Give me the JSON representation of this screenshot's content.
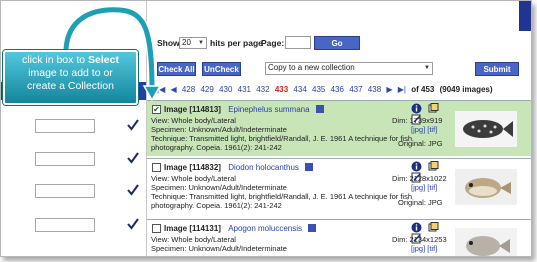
{
  "toolbar": {
    "show_label": "Show:",
    "show_value": "20",
    "hits_per_page_label": "hits per page",
    "page_label": "Page:",
    "page_value": "",
    "go_label": "Go",
    "check_all_label": "Check All",
    "uncheck_label": "UnCheck",
    "action_value": "Copy to a new collection",
    "submit_label": "Submit"
  },
  "pager": {
    "pages": [
      "428",
      "429",
      "430",
      "431",
      "432",
      "433",
      "434",
      "435",
      "436",
      "437",
      "438"
    ],
    "current": "433",
    "of_label": "of 453",
    "count_label": "(9049 images)"
  },
  "results": [
    {
      "checked": true,
      "image_label": "Image",
      "image_id": "[114813]",
      "species": "Epinephelus summana",
      "view": "View: Whole body/Lateral",
      "specimen": "Specimen: Unknown/Adult/Indeterminate",
      "technique": "Technique: Transmitted light, brightfield/Randall, J. E. 1961 A technique for fish",
      "technique2": "photography. Copeia. 1961(2): 241-242",
      "dim": "Dim: 1739x919",
      "links": "[jpg]  [tif]",
      "original": "Original: JPG"
    },
    {
      "checked": false,
      "image_label": "Image",
      "image_id": "[114832]",
      "species": "Diodon holocanthus",
      "view": "View: Whole body/Lateral",
      "specimen": "Specimen: Unknown/Adult/Indeterminate",
      "technique": "Technique: Transmitted light, brightfield/Randall, J. E. 1961 A technique for fish",
      "technique2": "photography. Copeia. 1961(2): 241-242",
      "dim": "Dim: 2128x1022",
      "links": "[jpg]  [tif]",
      "original": "Original: JPG"
    },
    {
      "checked": false,
      "image_label": "Image",
      "image_id": "[114131]",
      "species": "Apogon moluccensis",
      "view": "View: Whole body/Lateral",
      "specimen": "Specimen: Unknown/Adult/Indeterminate",
      "dim": "Dim: 2134x1253",
      "links": "[jpg]  [tif]"
    }
  ],
  "callout": {
    "line1_pre": "click in box to ",
    "line1_bold": "Select",
    "line2": "image to add to or",
    "line3": "create a Collection"
  },
  "colors": {
    "accent_blue": "#4a66c4",
    "selected_row": "#c8e5b8",
    "callout_teal": "#1e9fb6",
    "current_page_red": "#d61f1f"
  }
}
